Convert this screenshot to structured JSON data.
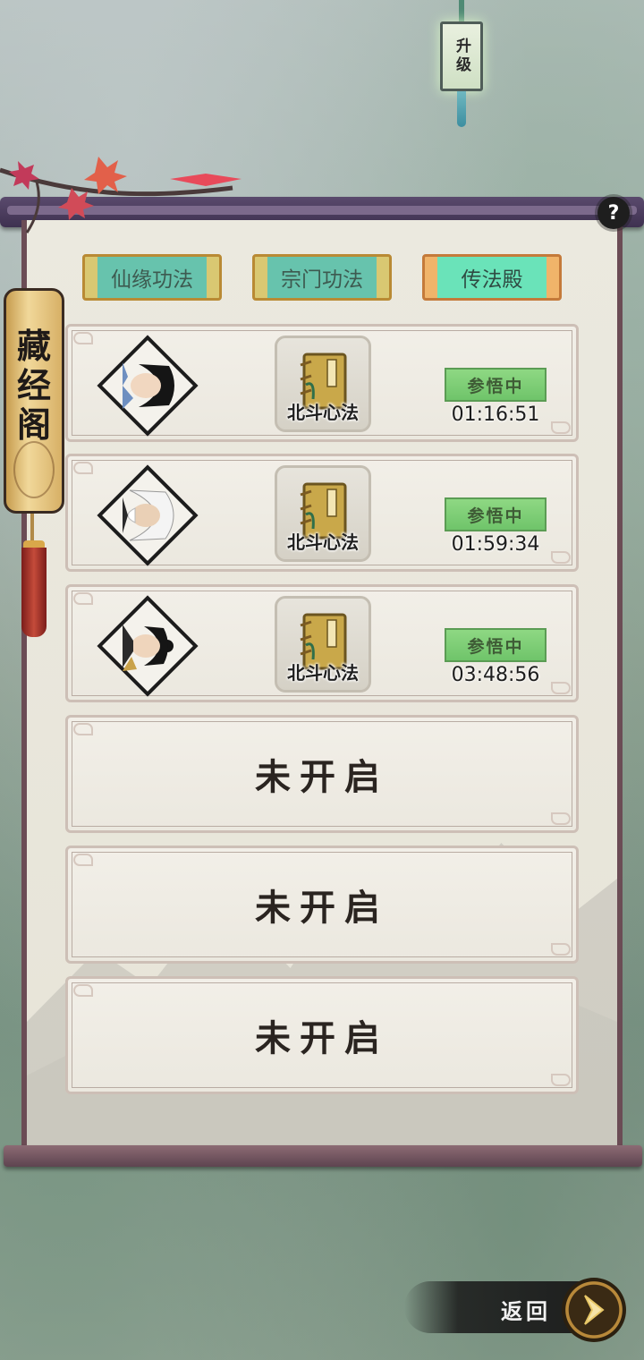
{
  "upgrade_tag": {
    "label": "升级"
  },
  "side_title": "藏经阁",
  "help_label": "?",
  "tabs": [
    {
      "label": "仙缘功法",
      "active": false
    },
    {
      "label": "宗门功法",
      "active": false
    },
    {
      "label": "传法殿",
      "active": true
    }
  ],
  "slots": [
    {
      "portrait": "young-man-long-black-hair",
      "book": "北斗心法",
      "status": "参悟中",
      "timer": "01:16:51"
    },
    {
      "portrait": "white-haired-elder",
      "book": "北斗心法",
      "status": "参悟中",
      "timer": "01:59:34"
    },
    {
      "portrait": "topknot-swordsman",
      "book": "北斗心法",
      "status": "参悟中",
      "timer": "03:48:56"
    }
  ],
  "locked_slots": [
    {
      "label": "未开启"
    },
    {
      "label": "未开启"
    },
    {
      "label": "未开启"
    }
  ],
  "back_button": {
    "label": "返回"
  },
  "colors": {
    "panel_bg": "#ebe9df",
    "rod": "#5a4a6d",
    "tab_active": "#6ae3b9",
    "tab_inactive": "#67c3ad",
    "status_green": "#8ed883"
  }
}
